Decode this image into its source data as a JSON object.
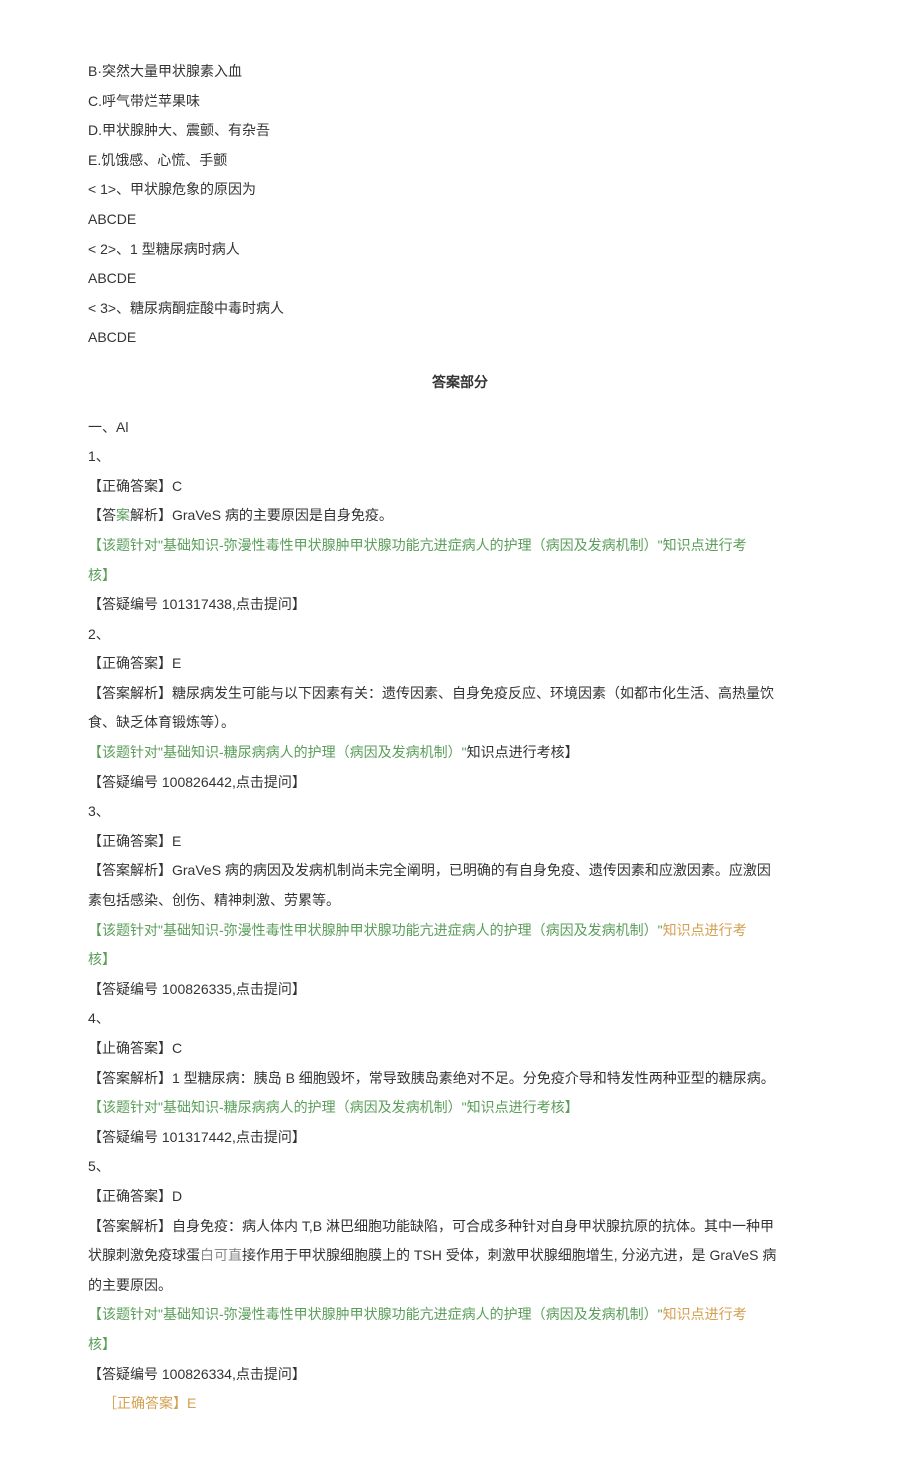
{
  "options": {
    "optB": "B·突然大量甲状腺素入血",
    "optC": "C.呼气带烂苹果味",
    "optD": "D.甲状腺肿大、震颤、有杂吾",
    "optE": "E.饥饿感、心慌、手颤"
  },
  "subQuestions": {
    "q1": "<   1>、甲状腺危象的原因为",
    "q1ans": "ABCDE",
    "q2": "<   2>、1 型糖尿病时病人",
    "q2ans": "ABCDE",
    "q3": "<   3>、糖尿病酮症酸中毒时病人",
    "q3ans": "ABCDE"
  },
  "sectionTitle": "答案部分",
  "sectionLabel": "一、Al",
  "answers": {
    "a1": {
      "num": "1、",
      "correct": "【正确答案】C",
      "analysisLabel": "【答",
      "analysisWord": "案",
      "analysisRest": "解析】GraVeS 病的主要原因是自身免疫。",
      "green1": "【该题针对\"基础知识-弥漫性毒性甲状腺肿甲状腺功能亢进症病人的护理（病因及发病机制）\"知识点进行考",
      "green2": "核】",
      "qid": "【答疑编号 101317438,点击提问】"
    },
    "a2": {
      "num": "2、",
      "correct": "【正确答案】E",
      "analysis1": "【答案解析】糖尿病发生可能与以下因素有关：遗传因素、自身免疫反应、环境因素（如都市化生活、高热量饮",
      "analysis2": "食、缺乏体育锻炼等）。",
      "greenPre": "【该题针对\"基础知识-糖尿病病人的护理（病因及发病机制）\"",
      "greenMid": "知识点进行考核】",
      "qid": "【答疑编号 100826442,点击提问】"
    },
    "a3": {
      "num": "3、",
      "correct": "【正确答案】E",
      "analysis1": "【答案解析】GraVeS 病的病因及发病机制尚未完全阐明，已明确的有自身免疫、遗传因素和应激因素。应激因",
      "analysis2": "素包括感染、创伤、精神刺激、劳累等。",
      "green1": "【该题针对\"基础知识-弥漫性毒性甲状腺肿甲状腺功能亢进症病人的护理（病因及发病机制）\"",
      "green1b": "知识点进行考",
      "green2": "核】",
      "qid": "【答疑编号 100826335,点击提问】"
    },
    "a4": {
      "num": "4、",
      "correct": "【止确答案】C",
      "analysis": "【答案解析】1 型糖尿病：胰岛 B 细胞毁坏，常导致胰岛素绝对不足。分免疫介导和特发性两种亚型的糖尿病。",
      "green": "【该题针对\"基础知识-糖尿病病人的护理（病因及发病机制）\"知识点进行考核】",
      "qid": "【答疑编号 101317442,点击提问】"
    },
    "a5": {
      "num": "5、",
      "correct": "【正确答案】D",
      "analysis1a": "【答案解析】自身免疫：病人体内 T,B 淋巴细胞功能缺陷，可合成多种针对自身甲状腺抗原的抗体。其中一种甲",
      "analysis2a": "状腺刺激免疫球蛋",
      "analysis2gray": "白可直",
      "analysis2b": "接作用于甲状腺细胞膜上的 TSH 受体，刺激甲状腺细胞增生, 分泌亢进，是 GraVeS 病",
      "analysis3": "的主要原因。",
      "green1": "【该题针对\"基础知识-弥漫性毒性甲状腺肿甲状腺功能亢进症病人的护理（病因及发病机制）\"",
      "green1b": "知识点进行考",
      "green2": "核】",
      "qid": "【答疑编号 100826334,点击提问】"
    },
    "lastLine": "［正确答案】E"
  }
}
